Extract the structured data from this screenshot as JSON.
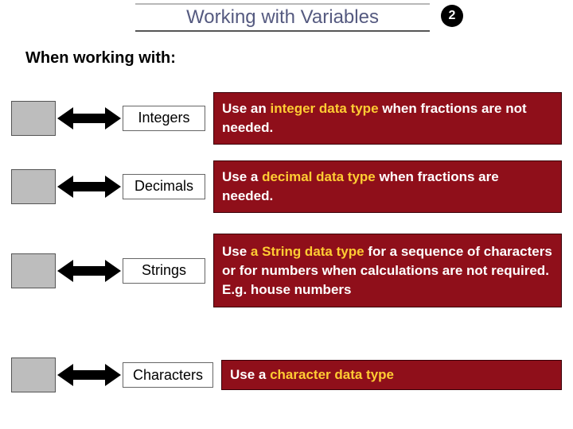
{
  "title": "Working with Variables",
  "page_number": "2",
  "subtitle": "When working with:",
  "rows": [
    {
      "label": "Integers",
      "desc_pre": "Use an ",
      "desc_hl": "integer data type",
      "desc_post": " when fractions are not needed."
    },
    {
      "label": "Decimals",
      "desc_pre": "Use a ",
      "desc_hl": "decimal data type",
      "desc_post": " when fractions are needed."
    },
    {
      "label": "Strings",
      "desc_pre": "Use ",
      "desc_hl": "a String data type",
      "desc_post": " for a sequence of characters  or for numbers when calculations are not required. E.g. house numbers"
    },
    {
      "label": "Characters",
      "desc_pre": "Use a ",
      "desc_hl": "character data type",
      "desc_post": ""
    }
  ]
}
